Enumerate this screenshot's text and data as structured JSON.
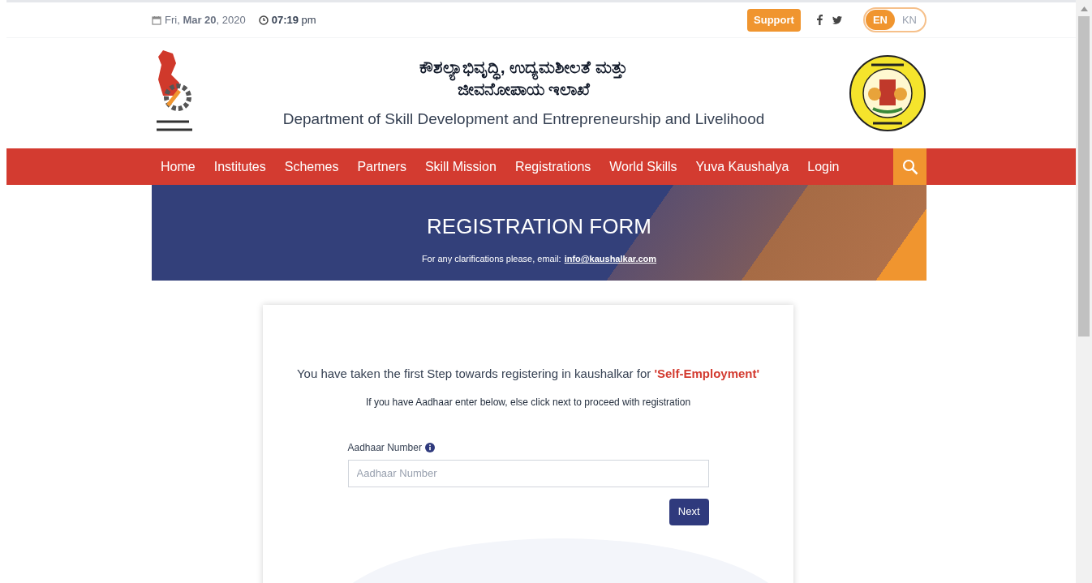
{
  "top_bar": {
    "date": "Fri, **Mar 20**, 2020",
    "time": "**07:19** pm",
    "support_button": "Support",
    "languages": [
      {
        "label": "EN",
        "selected": true
      },
      {
        "label": "KN",
        "selected": false
      }
    ]
  },
  "header": {
    "title_kannada_line_1": "ಕೌಶಲ್ಯಾಭಿವೃದ್ಧಿ, ಉದ್ಯಮಶೀಲತೆ ಮತ್ತು",
    "title_kannada_line_2": "ಜೀವನೋಪಾಯ ಇಲಾಖೆ",
    "title_english": "Department of Skill Development and Entrepreneurship and Livelihood"
  },
  "nav": {
    "items": [
      "Home",
      "Institutes",
      "Schemes",
      "Partners",
      "Skill Mission",
      "Registrations",
      "World Skills",
      "Yuva Kaushalya",
      "Login"
    ]
  },
  "banner": {
    "title": "REGISTRATION FORM",
    "note": "For any clarifications please, email:",
    "email": "info@kaushalkar.com"
  },
  "form": {
    "intro": "You have taken the first Step towards registering in kaushalkar for",
    "intro_highlight": "'Self-Employment'",
    "instruction": "If you have Aadhaar enter below, else click next to proceed with registration",
    "field_label": "Aadhaar Number",
    "placeholder": "Aadhaar Number",
    "next_button": "Next"
  }
}
